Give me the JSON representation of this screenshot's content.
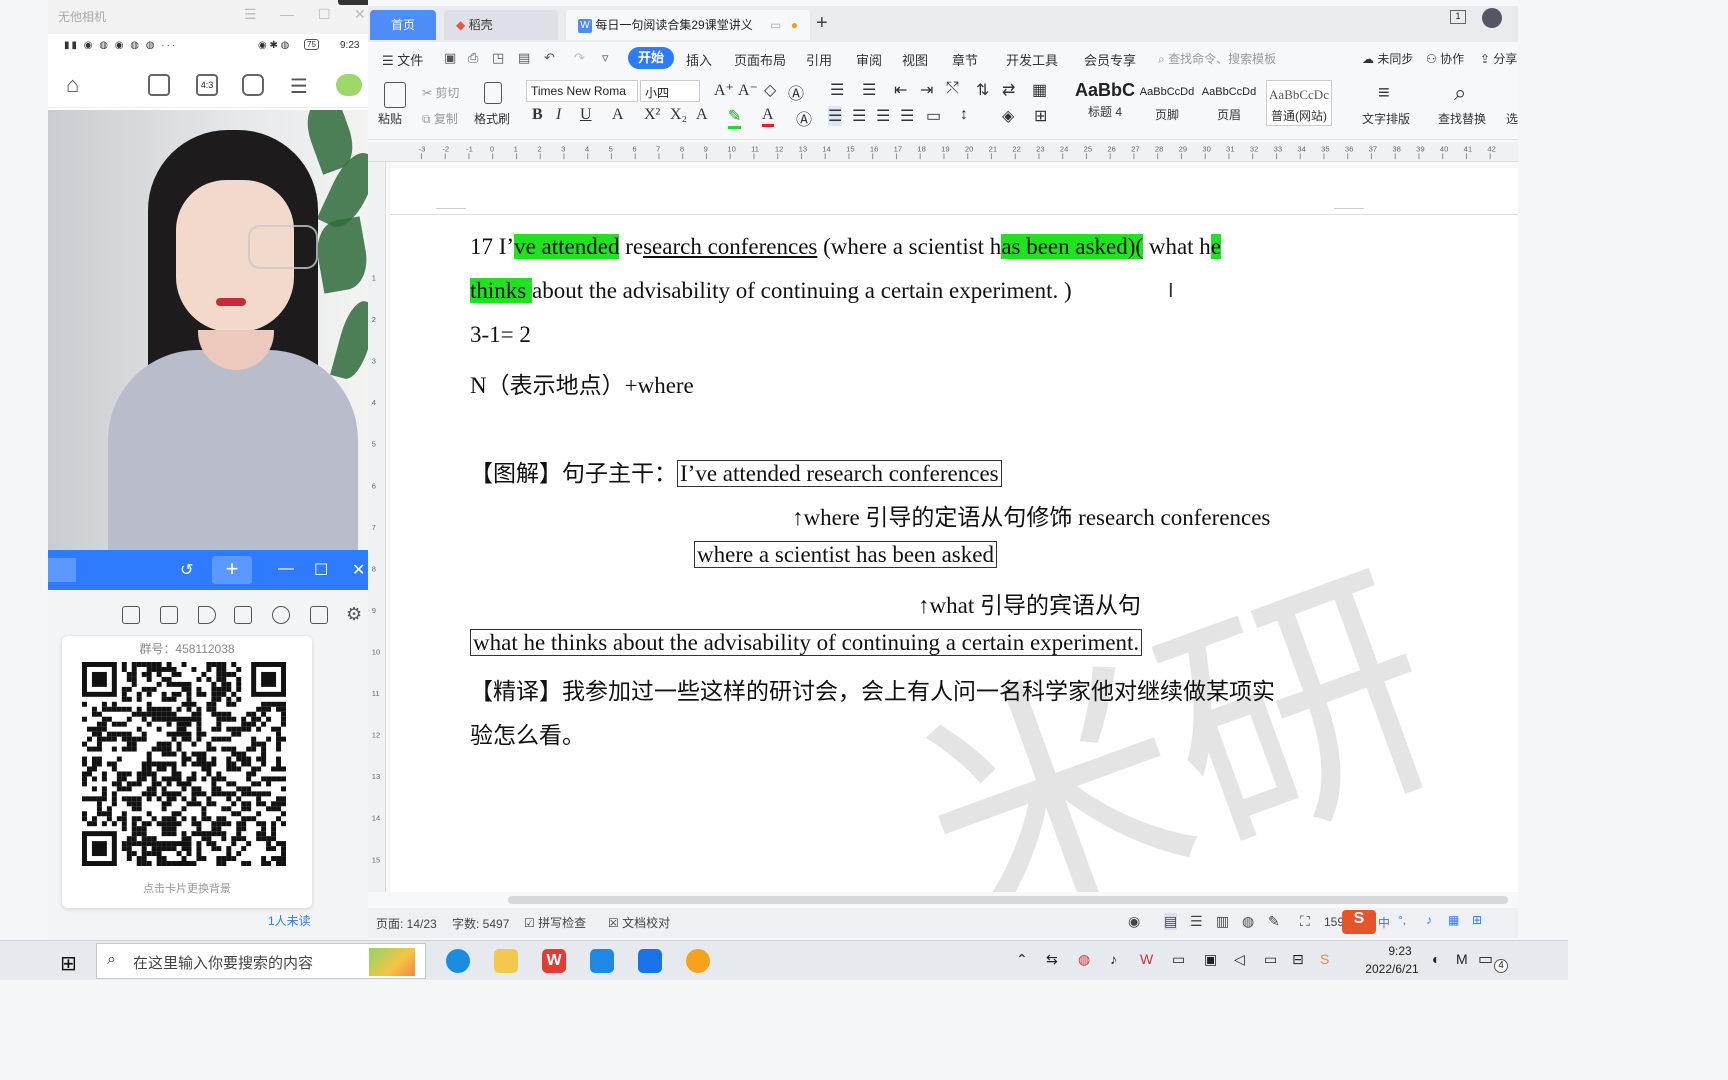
{
  "camera_window": {
    "title": "无他相机",
    "status_time": "9:23",
    "battery": "75"
  },
  "group_panel": {
    "group_number": "群号：458112038",
    "card_hint": "点击卡片更换背景",
    "unread": "1人未读"
  },
  "wps": {
    "tabs": {
      "home": "首页",
      "daoke": "稻壳",
      "doc": "每日一句阅读合集29课堂讲义"
    },
    "menu": {
      "file": "文件",
      "start": "开始",
      "insert": "插入",
      "layout": "页面布局",
      "reference": "引用",
      "review": "审阅",
      "view": "视图",
      "chapter": "章节",
      "devtools": "开发工具",
      "member": "会员专享",
      "search_placeholder": "查找命令、搜索模板",
      "unsynced": "未同步",
      "collab": "协作",
      "share": "分享"
    },
    "ribbon": {
      "paste": "粘贴",
      "cut": "剪切",
      "copy": "复制",
      "format_painter": "格式刷",
      "font": "Times New Roma",
      "size": "小四",
      "styles": [
        {
          "sample": "AaBbC",
          "label": "标题 4"
        },
        {
          "sample": "AaBbCcDd",
          "label": "页脚"
        },
        {
          "sample": "AaBbCcDd",
          "label": "页眉"
        },
        {
          "sample": "AaBbCcDc",
          "label": "普通(网站)"
        }
      ],
      "text_layout": "文字排版",
      "find_replace": "查找替换",
      "select": "选"
    },
    "document": {
      "line1_num": "17 I’",
      "line1_hl1": "ve attended",
      "line1_mid": " re",
      "line1_ul": "search conferences",
      "line1_b": " (where a scientist h",
      "line1_hl2": "as been asked)(",
      "line1_c": " what h",
      "line1_hl3": "e",
      "line2_hl": "thinks ",
      "line2_rest": "about the advisability of continuing a certain experiment. )",
      "line3": "3-1= 2",
      "line4": "N（表示地点）+where",
      "diagram_label": "【图解】句子主干：",
      "main_clause": "I’ve attended research conferences ",
      "note1": "↑where 引导的定语从句修饰 research conferences",
      "clause2": "where a scientist has been asked",
      "note2": "↑what 引导的宾语从句",
      "clause3": "what he thinks about the advisability of continuing a certain experiment.",
      "translation_1": "【精译】我参加过一些这样的研讨会，会上有人问一名科学家他对继续做某项实",
      "translation_2": "验怎么看。",
      "watermark": "米研"
    },
    "status": {
      "page": "页面: 14/23",
      "words": "字数: 5497",
      "spell": "拼写检查",
      "proof": "文档校对",
      "zoom": "159"
    }
  },
  "taskbar": {
    "search_placeholder": "在这里输入你要搜索的内容",
    "time": "9:23",
    "date": "2022/6/21",
    "ime": "中",
    "notifications": "4"
  }
}
